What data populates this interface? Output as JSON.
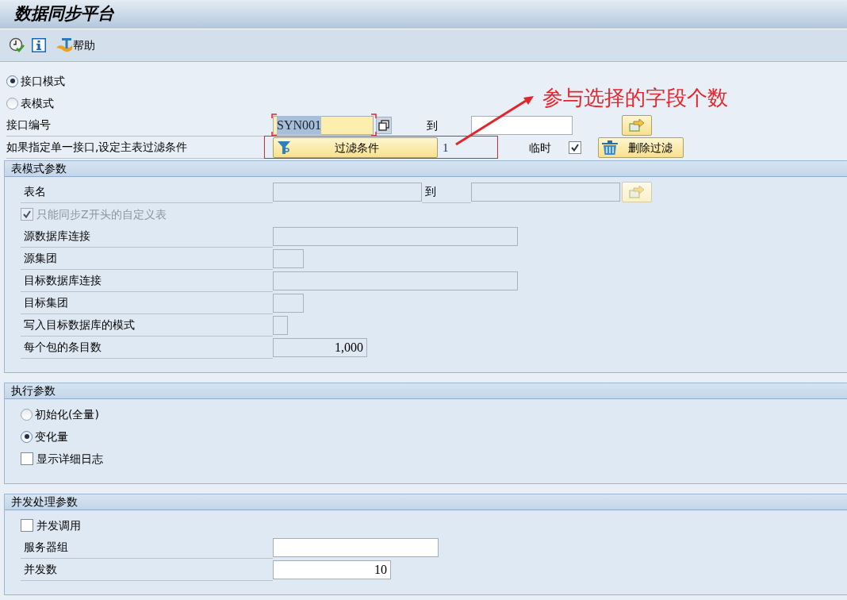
{
  "window": {
    "title": "数据同步平台"
  },
  "toolbar": {
    "help_button": "帮助"
  },
  "mode": [
    {
      "label": "接口模式",
      "selected": true
    },
    {
      "label": "表模式",
      "selected": false
    }
  ],
  "interface_number": {
    "label": "接口编号",
    "value": "SYN001",
    "focused": true,
    "to_label": "到"
  },
  "filter": {
    "label": "如果指定单一接口,设定主表过滤条件",
    "button": "过滤条件",
    "count": "1",
    "temp_label": "临时",
    "temp_checked": true,
    "delete_button": "删除过滤"
  },
  "annotation": {
    "text": "参与选择的字段个数"
  },
  "table_mode_params": {
    "title": "表模式参数",
    "disabled": true,
    "table_name": {
      "label": "表名",
      "to_label": "到"
    },
    "z_only": {
      "label": "只能同步Z开头的自定义表",
      "checked": true,
      "disabled": true
    },
    "fields": [
      {
        "label": "源数据库连接",
        "kind": "connection"
      },
      {
        "label": "源集团",
        "kind": "client"
      },
      {
        "label": "目标数据库连接",
        "kind": "connection"
      },
      {
        "label": "目标集团",
        "kind": "client"
      },
      {
        "label": "写入目标数据库的模式",
        "kind": "flag"
      },
      {
        "label": "每个包的条目数",
        "kind": "number",
        "value": "1,000"
      }
    ]
  },
  "exec_params": {
    "title": "执行参数",
    "load_mode": [
      {
        "label": "初始化(全量)",
        "selected": false
      },
      {
        "label": "变化量",
        "selected": true
      }
    ],
    "detail_log": {
      "label": "显示详细日志",
      "checked": false
    }
  },
  "parallel_params": {
    "title": "并发处理参数",
    "parallel_call": {
      "label": "并发调用",
      "checked": false
    },
    "fields": [
      {
        "label": "服务器组",
        "kind": "group"
      },
      {
        "label": "并发数",
        "kind": "number",
        "value": "10"
      }
    ]
  }
}
